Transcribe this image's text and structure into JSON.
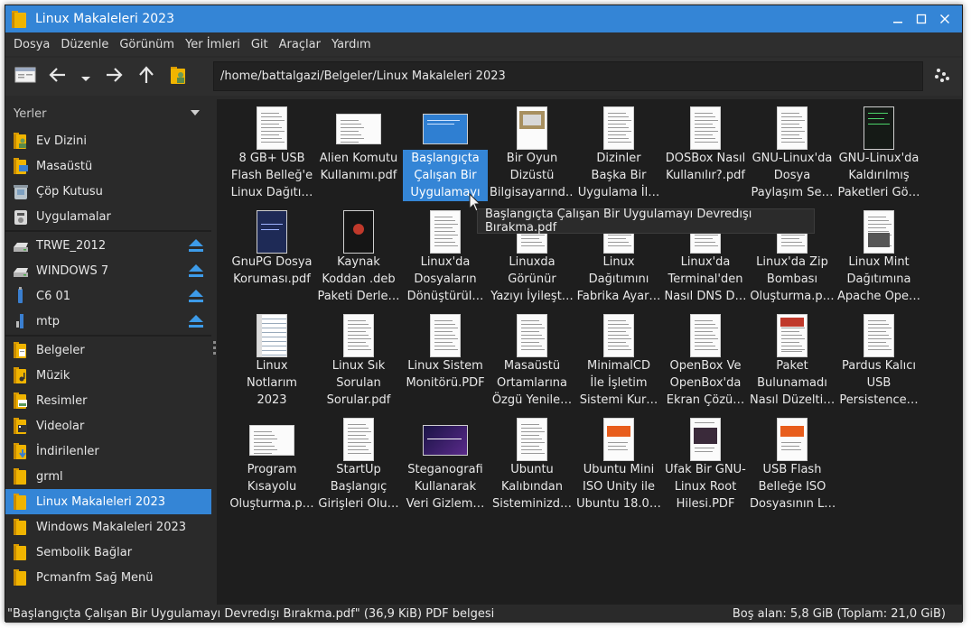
{
  "window": {
    "title": "Linux Makaleleri 2023"
  },
  "menu": [
    "Dosya",
    "Düzenle",
    "Görünüm",
    "Yer İmleri",
    "Git",
    "Araçlar",
    "Yardım"
  ],
  "toolbar": {
    "path": "/home/battalgazi/Belgeler/Linux Makaleleri 2023"
  },
  "sidebar": {
    "header": "Yerler",
    "places": [
      {
        "label": "Ev Dizini",
        "icon": "home-folder-icon"
      },
      {
        "label": "Masaüstü",
        "icon": "desktop-folder-icon"
      },
      {
        "label": "Çöp Kutusu",
        "icon": "trash-icon"
      },
      {
        "label": "Uygulamalar",
        "icon": "applications-icon"
      }
    ],
    "devices": [
      {
        "label": "TRWE_2012",
        "icon": "drive-icon"
      },
      {
        "label": "WINDOWS 7",
        "icon": "drive-icon"
      },
      {
        "label": "C6 01",
        "icon": "usb-drive-icon"
      },
      {
        "label": "mtp",
        "icon": "phone-icon"
      }
    ],
    "bookmarks": [
      {
        "label": "Belgeler"
      },
      {
        "label": "Müzik"
      },
      {
        "label": "Resimler"
      },
      {
        "label": "Videolar"
      },
      {
        "label": "İndirilenler"
      },
      {
        "label": "grml"
      },
      {
        "label": "Linux Makaleleri 2023",
        "selected": true
      },
      {
        "label": "Windows Makaleleri 2023"
      },
      {
        "label": "Sembolik Bağlar"
      },
      {
        "label": "Pcmanfm Sağ Menü"
      }
    ]
  },
  "files": [
    {
      "name": "8 GB+ USB\nFlash Belleğ'e\nLinux Dağıtı…",
      "thumb": "doc"
    },
    {
      "name": "Alien Komutu\nKullanımı.pdf",
      "thumb": "doc-wide"
    },
    {
      "name": "Başlangıçta\nÇalışan Bir\nUygulamayı",
      "thumb": "blue",
      "selected": true
    },
    {
      "name": "Bir Oyun\nDizüstü\nBilgisayarınd…",
      "thumb": "photo"
    },
    {
      "name": "Dizinler\nBaşka Bir\nUygulama İl…",
      "thumb": "doc"
    },
    {
      "name": "DOSBox Nasıl\nKullanılır?.pdf",
      "thumb": "doc"
    },
    {
      "name": "GNU-Linux'da\nDosya\nPaylaşım Se…",
      "thumb": "doc"
    },
    {
      "name": "GNU-Linux'da\nKaldırılmış\nPaketleri Gö…",
      "thumb": "terminal"
    },
    {
      "name": "GnuPG Dosya\nKoruması.pdf",
      "thumb": "dark-blue"
    },
    {
      "name": "Kaynak\nKoddan .deb\nPaketi Derle…",
      "thumb": "dark-red"
    },
    {
      "name": "Linux'da\nDosyaların\nDönüştürül…",
      "thumb": "doc"
    },
    {
      "name": "Linuxda\nGörünür\nYazıyı İyileşt…",
      "thumb": "doc"
    },
    {
      "name": "Linux\nDağıtımını\nFabrika Ayar…",
      "thumb": "doc"
    },
    {
      "name": "Linux'da\nTerminal'den\nNasıl DNS D…",
      "thumb": "doc"
    },
    {
      "name": "Linux'da Zip\nBombası\nOluşturma.p…",
      "thumb": "doc"
    },
    {
      "name": "Linux Mint\nDağıtımına\nApache Ope…",
      "thumb": "doc-gray"
    },
    {
      "name": "Linux\nNotlarım\n2023",
      "thumb": "notes"
    },
    {
      "name": "Linux Sık\nSorulan\nSorular.pdf",
      "thumb": "doc"
    },
    {
      "name": "Linux Sistem\nMonitörü.PDF",
      "thumb": "doc"
    },
    {
      "name": "Masaüstü\nOrtamlarına\nÖzgü Yenile…",
      "thumb": "doc"
    },
    {
      "name": "MinimalCD\nİle İşletim\nSistemi Kur…",
      "thumb": "doc"
    },
    {
      "name": "OpenBox Ve\nOpenBox'da\nEkran Çözü…",
      "thumb": "doc"
    },
    {
      "name": "Paket\nBulunamadı\nNasıl Düzelti…",
      "thumb": "doc-color"
    },
    {
      "name": "Pardus Kalıcı\nUSB\nPersistence…",
      "thumb": "doc"
    },
    {
      "name": "Program\nKısayolu\nOluşturma.p…",
      "thumb": "doc-wide"
    },
    {
      "name": "StartUp\nBaşlangıç\nGirişleri Olu…",
      "thumb": "doc"
    },
    {
      "name": "Steganografi\nKullanarak\nVeri Gizlem…",
      "thumb": "purple"
    },
    {
      "name": "Ubuntu\nKalıbından\nSisteminizd…",
      "thumb": "doc"
    },
    {
      "name": "Ubuntu Mini\nISO Unity ile\nUbuntu 18.0…",
      "thumb": "doc-orange"
    },
    {
      "name": "Ufak Bir GNU-\nLinux Root\nHilesi.PDF",
      "thumb": "doc-dark"
    },
    {
      "name": "USB Flash\nBelleğe ISO\nDosyasının L…",
      "thumb": "doc-orange"
    }
  ],
  "tooltip": "Başlangıçta Çalışan Bir Uygulamayı Devredışı Bırakma.pdf",
  "status": {
    "left": "\"Başlangıçta Çalışan Bir Uygulamayı Devredışı Bırakma.pdf\" (36,9 KiB) PDF belgesi",
    "right": "Boş alan: 5,8 GiB (Toplam: 21,0 GiB)"
  },
  "colors": {
    "accent": "#3485d6",
    "folder": "#f0b400",
    "eject": "#3d9be9"
  }
}
